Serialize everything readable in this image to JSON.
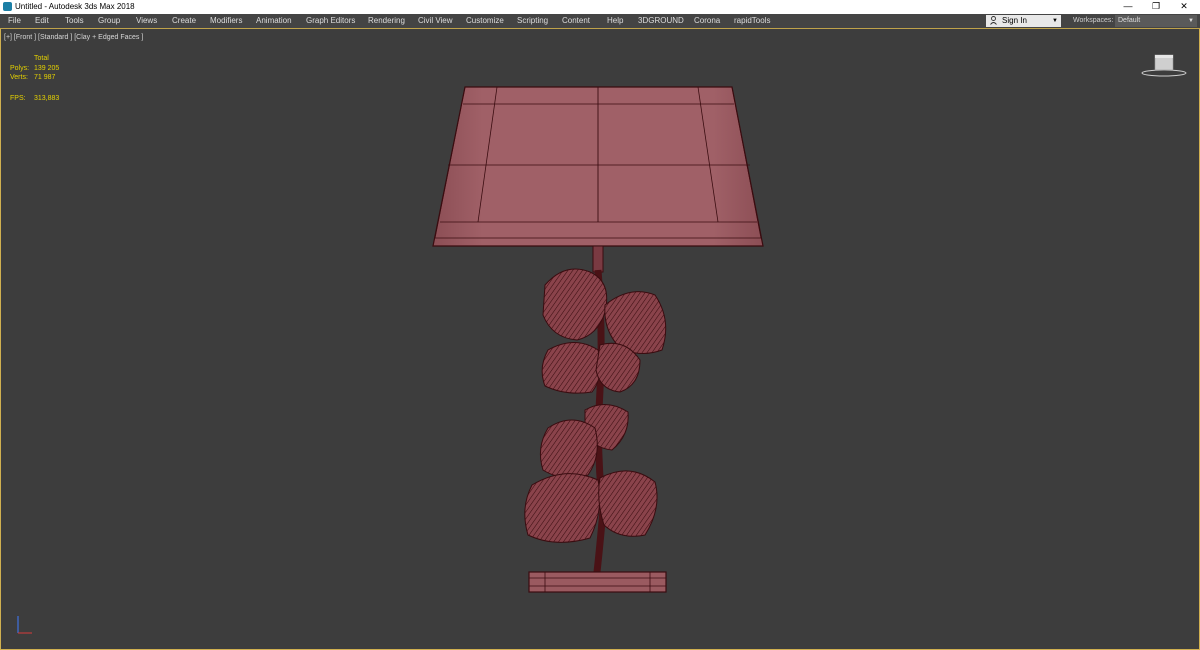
{
  "window": {
    "title": "Untitled - Autodesk 3ds Max 2018",
    "controls": [
      "—",
      "❐",
      "✕"
    ]
  },
  "menu": {
    "items": [
      "File",
      "Edit",
      "Tools",
      "Group",
      "Views",
      "Create",
      "Modifiers",
      "Animation",
      "Graph Editors",
      "Rendering",
      "Civil View",
      "Customize",
      "Scripting",
      "Content",
      "Help",
      "3DGROUND",
      "Corona",
      "rapidTools"
    ]
  },
  "account": {
    "signin_label": "Sign In",
    "workspaces_label": "Workspaces:",
    "workspace_value": "Default"
  },
  "viewport": {
    "label": "[+] [Front ] [Standard ] [Clay + Edged Faces ]",
    "stats": {
      "header": "Total",
      "polys_label": "Polys:",
      "polys_value": "139 205",
      "verts_label": "Verts:",
      "verts_value": "71 987",
      "fps_label": "FPS:",
      "fps_value": "313,883"
    }
  },
  "colors": {
    "accent": "#d0b050",
    "model_fill": "#9a5a60",
    "wire": "#3a0c10",
    "stat_text": "#e5d200"
  }
}
